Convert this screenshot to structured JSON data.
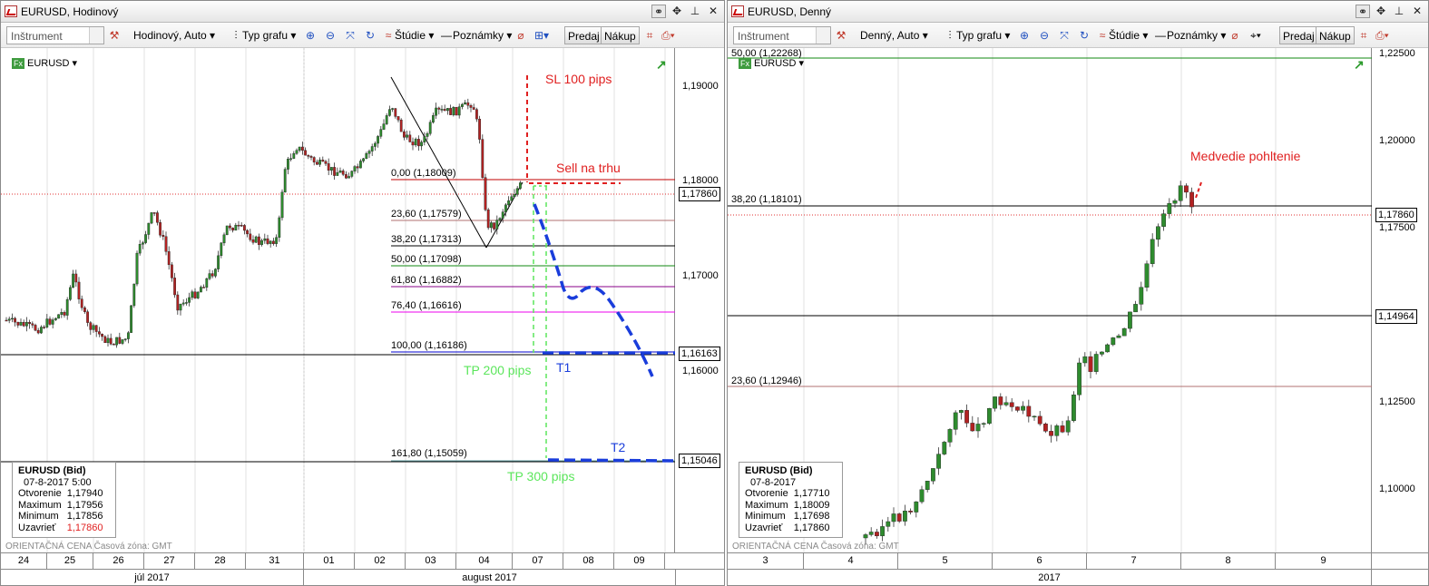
{
  "left": {
    "title": "EURUSD, Hodinový",
    "toolbar": {
      "instrument_placeholder": "Inštrument",
      "timeframe": "Hodinový, Auto",
      "chart_type": "Typ grafu",
      "studies": "Štúdie",
      "notes": "Poznámky",
      "sell": "Predaj",
      "buy": "Nákup"
    },
    "symbol": "EURUSD",
    "y_ticks": [
      "1,19000",
      "1,18000",
      "1,17000",
      "1,16000"
    ],
    "current_price": "1,17860",
    "price_markers": [
      "1,16163",
      "1,15046"
    ],
    "fib_levels": [
      {
        "label": "0,00 (1,18009)",
        "color": "#c00000"
      },
      {
        "label": "23,60 (1,17579)",
        "color": "#b07070"
      },
      {
        "label": "38,20 (1,17313)",
        "color": "#000000"
      },
      {
        "label": "50,00 (1,17098)",
        "color": "#118811"
      },
      {
        "label": "61,80 (1,16882)",
        "color": "#880088"
      },
      {
        "label": "76,40 (1,16616)",
        "color": "#ee00ee"
      },
      {
        "label": "100,00 (1,16186)",
        "color": "#0000cc"
      },
      {
        "label": "161,80 (1,15059)",
        "color": "#5f9ea0"
      }
    ],
    "annotations": {
      "sl": "SL 100 pips",
      "sell": "Sell na trhu",
      "tp200": "TP 200 pips",
      "t1": "T1",
      "t2": "T2",
      "tp300": "TP 300 pips"
    },
    "info": {
      "title": "EURUSD (Bid)",
      "date": "07-8-2017 5:00",
      "rows": [
        [
          "Otvorenie",
          "1,17940"
        ],
        [
          "Maximum",
          "1,17956"
        ],
        [
          "Minimum",
          "1,17856"
        ],
        [
          "Uzavrieť",
          "1,17860"
        ]
      ]
    },
    "bottom_text": "ORIENTAČNÁ CENA  Časová zóna: GMT",
    "x_days": [
      "24",
      "25",
      "26",
      "27",
      "28",
      "31",
      "01",
      "02",
      "03",
      "04",
      "07",
      "08",
      "09"
    ],
    "x_months": [
      "júl 2017",
      "august 2017"
    ]
  },
  "right": {
    "title": "EURUSD, Denný",
    "toolbar": {
      "instrument_placeholder": "Inštrument",
      "timeframe": "Denný, Auto",
      "chart_type": "Typ grafu",
      "studies": "Štúdie",
      "notes": "Poznámky",
      "sell": "Predaj",
      "buy": "Nákup"
    },
    "symbol": "EURUSD",
    "y_ticks": [
      "1,22500",
      "1,20000",
      "1,17500",
      "1,12500",
      "1,10000"
    ],
    "current_price": "1,17860",
    "price_markers": [
      "1,14964"
    ],
    "fib_levels": [
      {
        "label": "50,00 (1,22268)",
        "color": "#118811"
      },
      {
        "label": "38,20 (1,18101)",
        "color": "#000000"
      },
      {
        "label": "23,60 (1,12946)",
        "color": "#b07070"
      }
    ],
    "annotations": {
      "pattern": "Medvedie pohltenie"
    },
    "info": {
      "title": "EURUSD (Bid)",
      "date": "07-8-2017",
      "rows": [
        [
          "Otvorenie",
          "1,17710"
        ],
        [
          "Maximum",
          "1,18009"
        ],
        [
          "Minimum",
          "1,17698"
        ],
        [
          "Uzavrieť",
          "1,17860"
        ]
      ]
    },
    "bottom_text": "ORIENTAČNÁ CENA  Časová zóna: GMT",
    "x_days": [
      "3",
      "4",
      "5",
      "6",
      "7",
      "8",
      "9"
    ],
    "x_year": "2017"
  },
  "colors": {
    "bull": "#2e8b2e",
    "bear": "#b22222",
    "annotation_red": "#e02020",
    "annotation_green": "#5ce65c",
    "annotation_blue": "#1a3ddb"
  }
}
